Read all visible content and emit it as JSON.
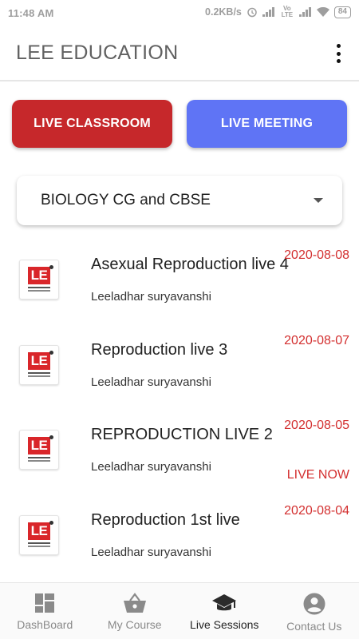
{
  "status_bar": {
    "time": "11:48 AM",
    "speed": "0.2KB/s",
    "network": "Vo LTE",
    "battery": "84"
  },
  "app_bar": {
    "title": "LEE EDUCATION"
  },
  "buttons": {
    "live_classroom": "LIVE CLASSROOM",
    "live_meeting": "LIVE MEETING"
  },
  "course_select": {
    "value": "BIOLOGY CG and CBSE"
  },
  "sessions": [
    {
      "title": "Asexual Reproduction live 4",
      "author": "Leeladhar suryavanshi",
      "date": "2020-08-08",
      "live": ""
    },
    {
      "title": "Reproduction live 3",
      "author": "Leeladhar suryavanshi",
      "date": "2020-08-07",
      "live": ""
    },
    {
      "title": "REPRODUCTION LIVE 2",
      "author": "Leeladhar suryavanshi",
      "date": "2020-08-05",
      "live": "LIVE NOW"
    },
    {
      "title": "Reproduction 1st live",
      "author": "Leeladhar suryavanshi",
      "date": "2020-08-04",
      "live": ""
    }
  ],
  "logo_text": "LE",
  "bottom_nav": [
    {
      "label": "DashBoard",
      "icon": "dashboard-icon"
    },
    {
      "label": "My Course",
      "icon": "basket-icon"
    },
    {
      "label": "Live Sessions",
      "icon": "graduation-cap-icon",
      "active": true
    },
    {
      "label": "Contact Us",
      "icon": "account-circle-icon"
    }
  ],
  "colors": {
    "classroom": "#c6282b",
    "meeting": "#5f74f5",
    "date_red": "#d32f2f"
  }
}
